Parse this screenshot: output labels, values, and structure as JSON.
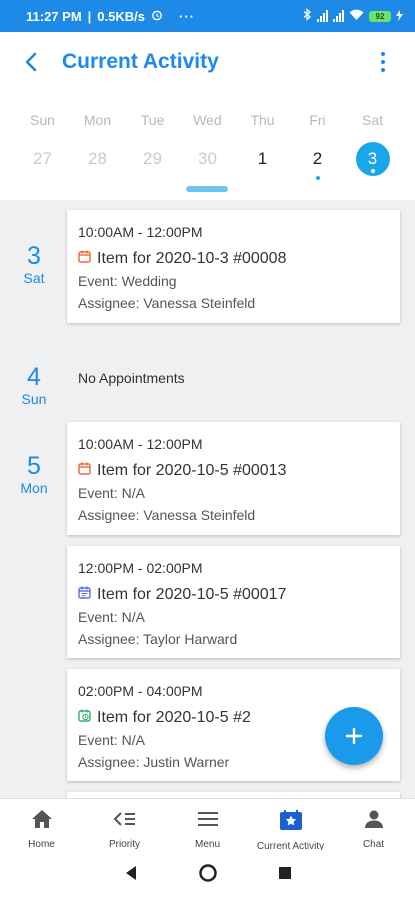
{
  "status_bar": {
    "time": "11:27 PM",
    "speed": "0.5KB/s",
    "more": "···",
    "battery": "92"
  },
  "header": {
    "title": "Current Activity",
    "back_icon": "back-arrow-icon",
    "menu_icon": "more-vert-icon"
  },
  "week": {
    "days": [
      {
        "name": "Sun",
        "num": "27",
        "state": "past",
        "dot": false
      },
      {
        "name": "Mon",
        "num": "28",
        "state": "past",
        "dot": false
      },
      {
        "name": "Tue",
        "num": "29",
        "state": "past",
        "dot": false
      },
      {
        "name": "Wed",
        "num": "30",
        "state": "past",
        "dot": false
      },
      {
        "name": "Thu",
        "num": "1",
        "state": "current",
        "dot": false
      },
      {
        "name": "Fri",
        "num": "2",
        "state": "current",
        "dot": true
      },
      {
        "name": "Sat",
        "num": "3",
        "state": "selected",
        "dot": true
      }
    ]
  },
  "agenda": [
    {
      "day_num": "3",
      "day_name": "Sat",
      "events": [
        {
          "time": "10:00AM - 12:00PM",
          "title": "Item for 2020-10-3 #00008",
          "event": "Event: Wedding",
          "assignee": "Assignee: Vanessa Steinfeld",
          "icon_color": "#f0673a"
        }
      ]
    },
    {
      "day_num": "4",
      "day_name": "Sun",
      "empty_text": "No Appointments",
      "events": []
    },
    {
      "day_num": "5",
      "day_name": "Mon",
      "events": [
        {
          "time": "10:00AM - 12:00PM",
          "title": "Item for 2020-10-5 #00013",
          "event": "Event: N/A",
          "assignee": "Assignee: Vanessa Steinfeld",
          "icon_color": "#f0673a"
        },
        {
          "time": "12:00PM - 02:00PM",
          "title": "Item for 2020-10-5 #00017",
          "event": "Event: N/A",
          "assignee": "Assignee: Taylor Harward",
          "icon_color": "#5b6fd6"
        },
        {
          "time": "02:00PM - 04:00PM",
          "title": "Item for 2020-10-5 #2",
          "event": "Event: N/A",
          "assignee": "Assignee: Justin Warner",
          "icon_color": "#36b36a"
        }
      ]
    }
  ],
  "bottom_nav": {
    "tabs": [
      {
        "label": "Home",
        "icon": "home-icon"
      },
      {
        "label": "Priority",
        "icon": "priority-icon"
      },
      {
        "label": "Menu",
        "icon": "menu-icon"
      },
      {
        "label": "Current Activity",
        "icon": "current-activity-icon"
      },
      {
        "label": "Chat",
        "icon": "chat-icon"
      }
    ]
  },
  "colors": {
    "accent": "#1c8ae6",
    "selected_day": "#1aa7ea",
    "fab": "#1c9aea"
  }
}
